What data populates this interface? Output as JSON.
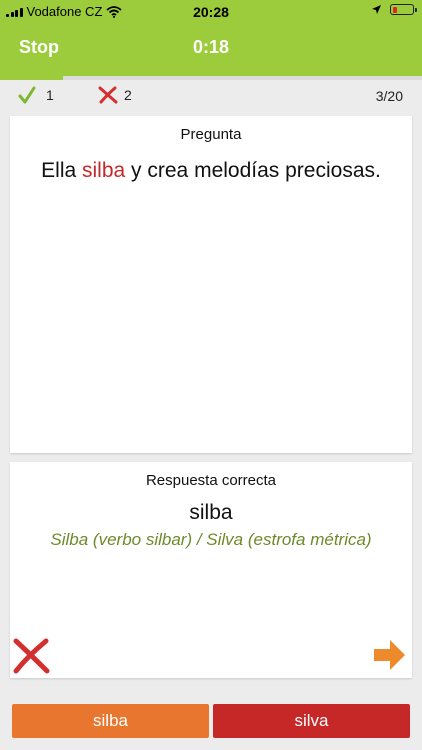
{
  "status_bar": {
    "carrier": "Vodafone CZ",
    "time": "20:28"
  },
  "header": {
    "stop_label": "Stop",
    "timer": "0:18"
  },
  "progress": {
    "fraction": 0.15
  },
  "score": {
    "correct": "1",
    "wrong": "2",
    "counter": "3/20"
  },
  "question": {
    "label": "Pregunta",
    "text_before": "Ella ",
    "highlight": "silba",
    "text_after": " y crea melodías preciosas."
  },
  "answer": {
    "label": "Respuesta correcta",
    "word": "silba",
    "note": "Silba (verbo silbar) / Silva (estrofa métrica)"
  },
  "choices": {
    "left": "silba",
    "right": "silva"
  },
  "colors": {
    "header_green": "#9ccb3b",
    "highlight_red": "#c62828",
    "note_green": "#6d8a2a",
    "choice_orange": "#e8762f",
    "choice_red": "#c62828"
  }
}
